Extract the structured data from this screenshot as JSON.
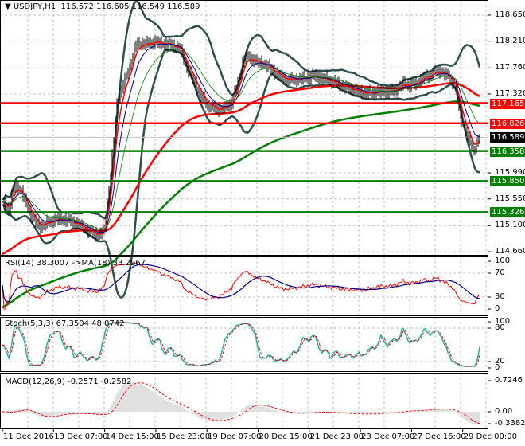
{
  "header": {
    "symbol": "USDJPY,H1",
    "ohlc": "116.572 116.605 116.549 116.589"
  },
  "colors": {
    "up_level": "#ff0000",
    "down_level": "#008000",
    "bands": "#2f4f4f",
    "ma_fast": "#ff0000",
    "ma_mid": "#00008b",
    "ma_slow": "#008000",
    "stoch_main": "#20b2aa",
    "macd_hist": "#c0c0c0"
  },
  "chart_data": [
    {
      "type": "candlestick",
      "title": "USDJPY,H1",
      "ylim": [
        114.66,
        118.65
      ],
      "y_ticks": [
        "118.650",
        "118.210",
        "117.760",
        "117.320",
        "115.990",
        "115.550",
        "115.100",
        "114.660"
      ],
      "x_ticks": [
        "11 Dec 2016",
        "13 Dec 07:00",
        "14 Dec 15:00",
        "15 Dec 23:00",
        "19 Dec 07:00",
        "20 Dec 15:00",
        "21 Dec 23:00",
        "23 Dec 07:00",
        "27 Dec 16:00",
        "29 Dec 00:00"
      ],
      "bar_step_hours": 4,
      "close": [
        115.478,
        115.384,
        115.787,
        115.68,
        115.384,
        115.169,
        115.075,
        115.142,
        115.196,
        115.209,
        115.196,
        115.156,
        115.115,
        115.048,
        114.981,
        114.941,
        115.008,
        115.949,
        117.158,
        117.494,
        117.763,
        118.166,
        118.166,
        118.166,
        118.206,
        118.166,
        118.166,
        118.126,
        118.072,
        117.763,
        117.561,
        117.319,
        117.158,
        117.091,
        117.051,
        117.091,
        117.185,
        117.494,
        117.938,
        117.938,
        117.857,
        117.83,
        117.763,
        117.669,
        117.588,
        117.561,
        117.561,
        117.575,
        117.602,
        117.629,
        117.588,
        117.561,
        117.521,
        117.481,
        117.427,
        117.4,
        117.36,
        117.333,
        117.333,
        117.36,
        117.36,
        117.36,
        117.4,
        117.494,
        117.467,
        117.494,
        117.588,
        117.615,
        117.696,
        117.696,
        117.615,
        117.494,
        116.957,
        116.621,
        116.379,
        116.589
      ],
      "levels": [
        {
          "value": "117.165",
          "color": "#ff0000"
        },
        {
          "value": "116.826",
          "color": "#ff0000"
        },
        {
          "value": "116.358",
          "color": "#008000"
        },
        {
          "value": "115.850",
          "color": "#008000"
        },
        {
          "value": "115.326",
          "color": "#008000"
        }
      ],
      "current_price": "116.589",
      "overlays": [
        "Bollinger Bands",
        "MA fast",
        "MA mid",
        "MA slow",
        "MA 100",
        "MA 200"
      ]
    },
    {
      "type": "line",
      "label": "RSI(14) 38.3007  ->MA(18) 33.2967",
      "ylim": [
        0,
        100
      ],
      "y_ticks": [
        "100",
        "70",
        "30",
        "0"
      ]
    },
    {
      "type": "line",
      "label": "Stoch(5,3,3) 67.3504 48.0742",
      "ylim": [
        0,
        100
      ],
      "y_ticks": [
        "100",
        "80",
        "20",
        "0"
      ]
    },
    {
      "type": "bar",
      "label": "MACD(12,26,9) -0.2571 -0.2582",
      "ylim": [
        -0.3382,
        0.7246
      ],
      "y_ticks": [
        "0.7246",
        "0.00",
        "-0.3382"
      ]
    }
  ]
}
